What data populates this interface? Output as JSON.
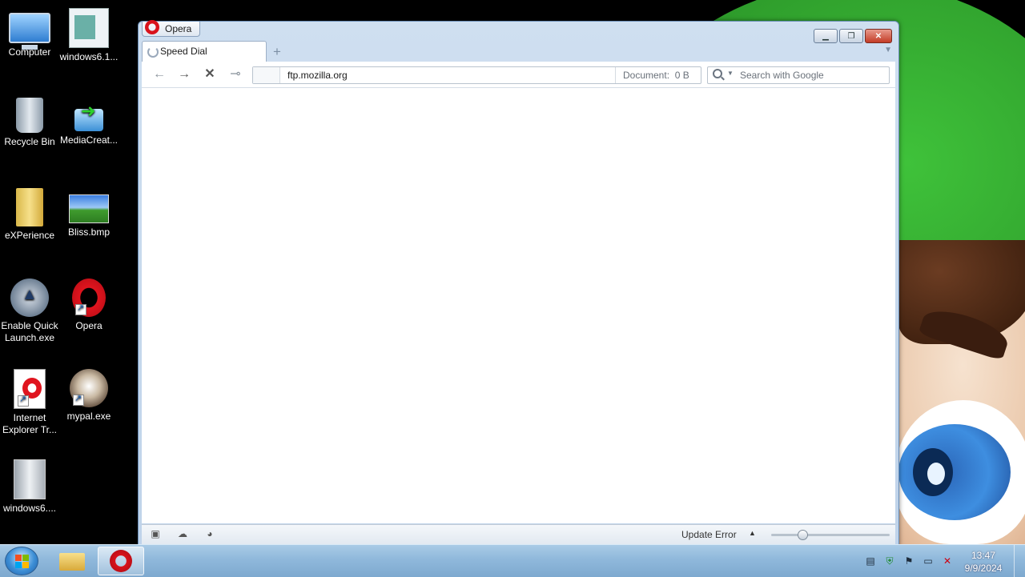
{
  "desktop": {
    "icons": [
      {
        "label": "Computer",
        "icon": "computer-icon"
      },
      {
        "label": "windows6.1...",
        "icon": "document-icon"
      },
      {
        "label": "Recycle Bin",
        "icon": "recycle-bin-icon"
      },
      {
        "label": "MediaCreat...",
        "icon": "media-creation-icon"
      },
      {
        "label": "eXPerience",
        "icon": "folder-icon"
      },
      {
        "label": "Bliss.bmp",
        "icon": "image-icon"
      },
      {
        "label": "Enable Quick Launch.exe",
        "icon": "quick-launch-icon"
      },
      {
        "label": "Opera",
        "icon": "opera-icon"
      },
      {
        "label": "Internet Explorer Tr...",
        "icon": "ie-transfer-icon"
      },
      {
        "label": "mypal.exe",
        "icon": "mypal-icon"
      },
      {
        "label": "windows6....",
        "icon": "installer-icon"
      }
    ]
  },
  "browser": {
    "menu_label": "Opera",
    "tab_label": "Speed Dial",
    "address_value": "ftp.mozilla.org",
    "document_label": "Document:",
    "document_size": "0 B",
    "search_placeholder": "Search with Google",
    "status_text": "Update Error",
    "zoom_level": 0.26
  },
  "taskbar": {
    "clock_time": "13:47",
    "clock_date": "9/9/2024"
  },
  "colors": {
    "taskbar": "#8fb8db",
    "window_frame": "#c8dbee",
    "close_button": "#c33b26",
    "opera_red": "#d9121b"
  }
}
